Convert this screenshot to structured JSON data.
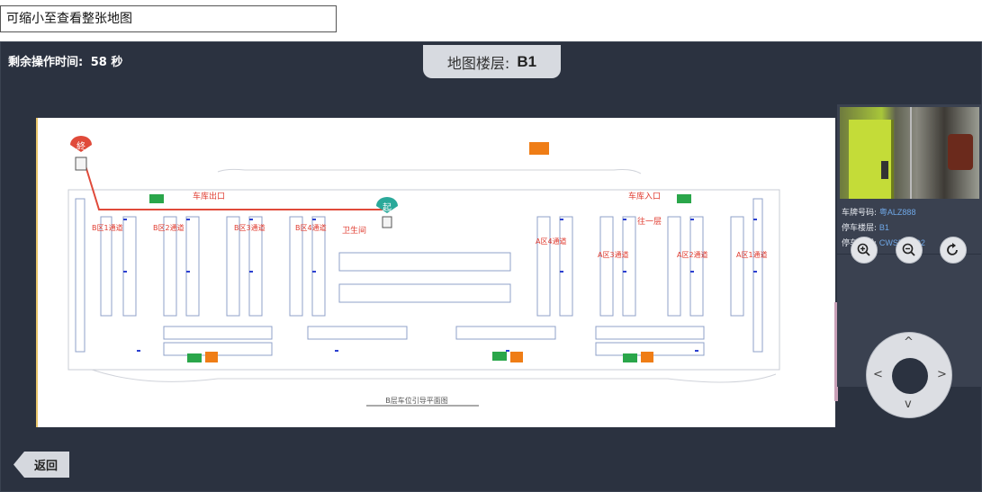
{
  "top_input": {
    "value": "可缩小至查看整张地图"
  },
  "timer": {
    "label": "剩余操作时间:",
    "value": "58 秒"
  },
  "floor_pill": {
    "label": "地图楼层:",
    "value": "B1"
  },
  "map": {
    "end_marker": "終",
    "start_marker": "起",
    "labels": {
      "exit": "车库出口",
      "entrance": "车库入口",
      "restroom": "卫生间",
      "stairs": "往一层",
      "caption": "B层车位引导平面图",
      "zones": [
        "B区1通道",
        "B区2通道",
        "B区3通道",
        "B区4通道",
        "A区4通道",
        "A区3通道",
        "A区2通道",
        "A区1通道"
      ]
    }
  },
  "info": {
    "plate_label": "车牌号码:",
    "plate_value": "粤ALZ888",
    "floor_label": "停车楼层:",
    "floor_value": "B1",
    "spot_label": "停车位置:",
    "spot_value": "CWSPTCQ2"
  },
  "controls": {
    "zoom_in": "zoom-in-icon",
    "zoom_out": "zoom-out-icon",
    "rotate": "rotate-icon"
  },
  "back_button": {
    "label": "返回"
  },
  "colors": {
    "panel_bg": "#2b3240",
    "route": "#e04a3a",
    "start": "#2aa99a",
    "sign_green": "#2aa64a",
    "sign_orange": "#ef7d16",
    "value_blue": "#6fa7e6"
  }
}
